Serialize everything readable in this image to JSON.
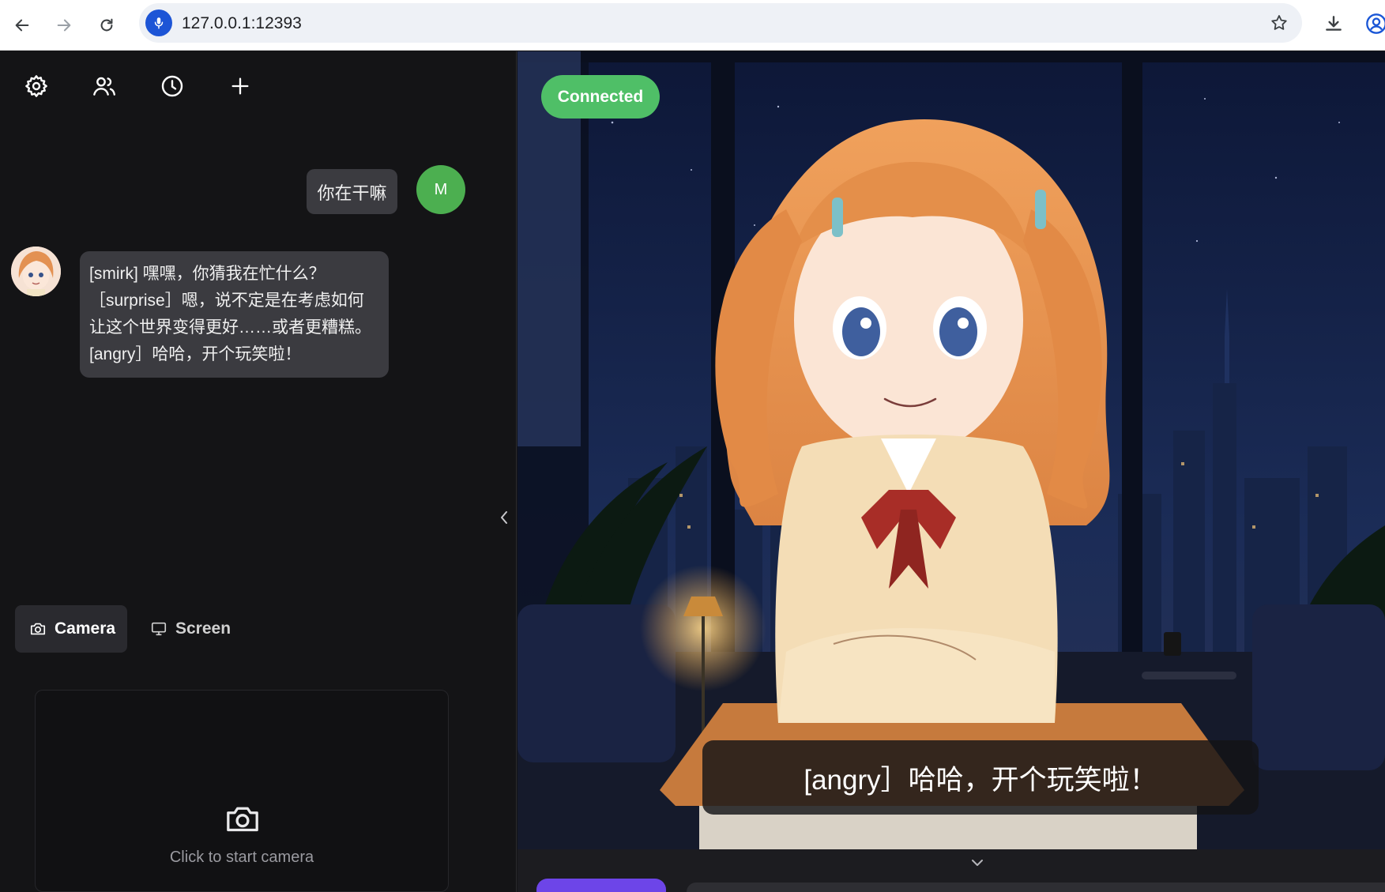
{
  "browser": {
    "url": "127.0.0.1:12393",
    "icons": [
      "back-arrow-icon",
      "forward-arrow-icon",
      "reload-icon",
      "microphone-icon",
      "bookmark-star-icon",
      "download-icon",
      "profile-icon"
    ]
  },
  "toolbar": {
    "icons": [
      "gear-icon",
      "people-icon",
      "clock-icon",
      "plus-icon"
    ]
  },
  "chat": {
    "user_message": "你在干嘛",
    "user_avatar_letter": "M",
    "ai_message": "[smirk] 嘿嘿，你猜我在忙什么？［surprise］嗯，说不定是在考虑如何让这个世界变得更好……或者更糟糕。[angry］哈哈，开个玩笑啦！"
  },
  "media_tabs": {
    "camera_label": "Camera",
    "screen_label": "Screen",
    "active": "Camera"
  },
  "camera_panel": {
    "hint": "Click to start camera"
  },
  "stage": {
    "status": "Connected",
    "subtitle": "[angry］哈哈，开个玩笑啦！"
  },
  "colors": {
    "connected": "#4fbf67",
    "user_avatar": "#4caf50",
    "accent_button": "#6d45e8",
    "panel_bg": "#141416"
  }
}
